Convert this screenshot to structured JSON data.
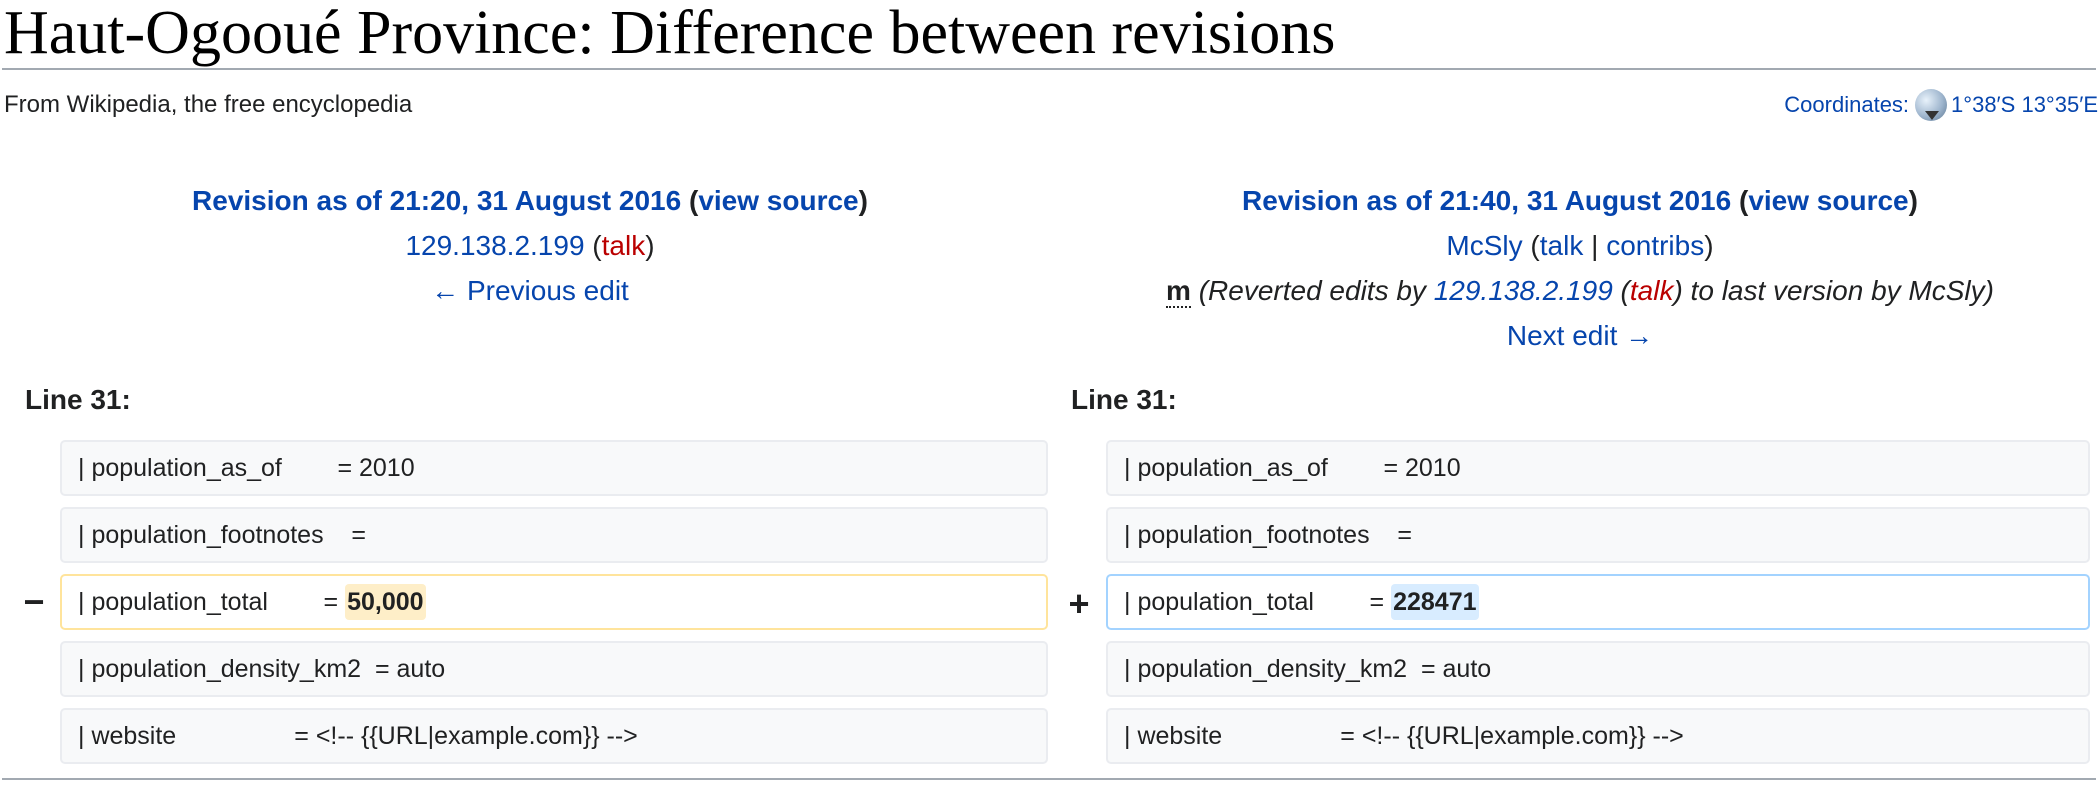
{
  "page": {
    "title": "Haut-Ogooué Province: Difference between revisions",
    "tagline": "From Wikipedia, the free encyclopedia",
    "coordinates_label": "Coordinates:",
    "coordinates_value": "1°38′S 13°35′E"
  },
  "old_revision": {
    "title_link": "Revision as of 21:20, 31 August 2016",
    "paren_open": " (",
    "view_source": "view source",
    "paren_close": ")",
    "user": "129.138.2.199",
    "user_paren_open": " (",
    "talk": "talk",
    "user_paren_close": ")",
    "nav": "← Previous edit"
  },
  "new_revision": {
    "title_link": "Revision as of 21:40, 31 August 2016",
    "paren_open": " (",
    "view_source": "view source",
    "paren_close": ")",
    "user": "McSly",
    "user_paren_open": " (",
    "talk": "talk",
    "separator": " | ",
    "contribs": "contribs",
    "user_paren_close": ")",
    "minor": "m",
    "summary_prefix": " (Reverted edits by ",
    "summary_user": "129.138.2.199",
    "summary_paren_open": " (",
    "summary_talk": "talk",
    "summary_suffix": ") to last version by McSly)",
    "nav": "Next edit →"
  },
  "diff": {
    "left_line": "Line 31:",
    "right_line": "Line 31:",
    "minus": "−",
    "plus": "+",
    "rows": [
      {
        "text": "| population_as_of        = 2010"
      },
      {
        "text": "| population_footnotes    = "
      },
      {
        "prefix": "| population_total        = ",
        "old": "50,000",
        "new": "228471"
      },
      {
        "text": "| population_density_km2  = auto"
      },
      {
        "text": "| website                 = <!-- {{URL|example.com}} -->"
      }
    ]
  }
}
